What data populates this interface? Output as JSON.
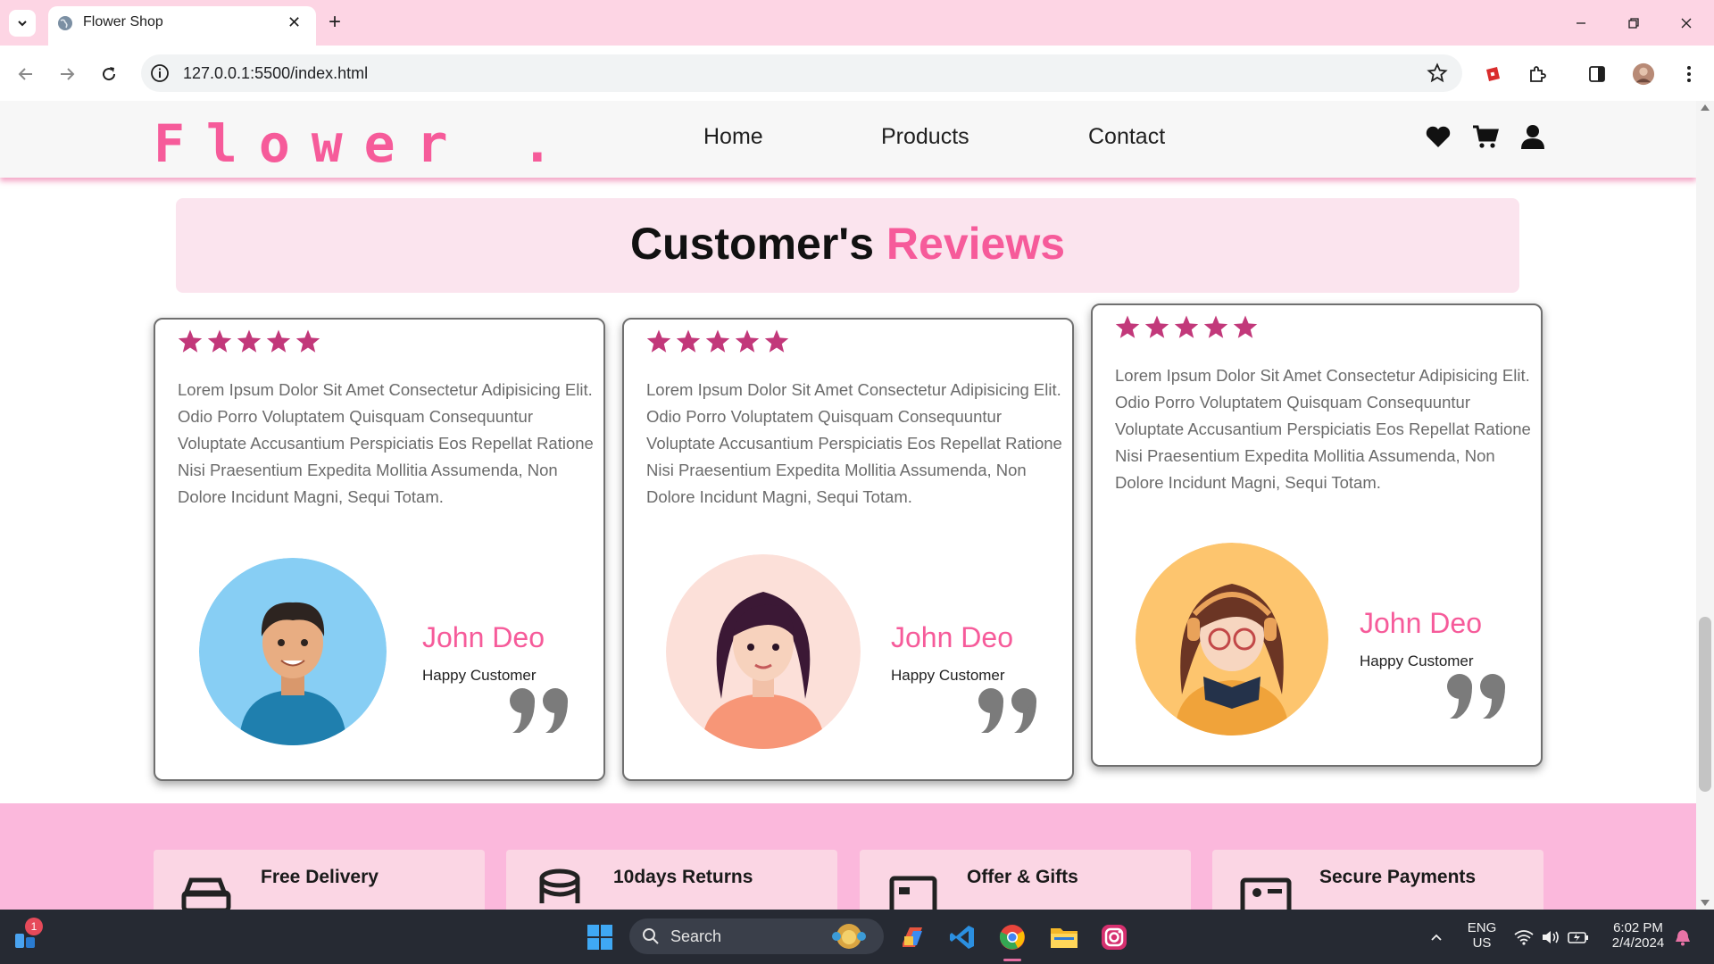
{
  "browser": {
    "tab_title": "Flower Shop",
    "url": "127.0.0.1:5500/index.html"
  },
  "site": {
    "logo": "Flower .",
    "nav": [
      "Home",
      "Products",
      "Contact"
    ]
  },
  "reviews": {
    "title_prefix": "Customer's",
    "title_accent": "Reviews",
    "items": [
      {
        "stars": 5,
        "text": "Lorem Ipsum Dolor Sit Amet Consectetur Adipisicing Elit. Odio Porro Voluptatem Quisquam Consequuntur Voluptate Accusantium Perspiciatis Eos Repellat Ratione Nisi Praesentium Expedita Mollitia Assumenda, Non Dolore Incidunt Magni, Sequi Totam.",
        "name": "John Deo",
        "role": "Happy Customer"
      },
      {
        "stars": 5,
        "text": "Lorem Ipsum Dolor Sit Amet Consectetur Adipisicing Elit. Odio Porro Voluptatem Quisquam Consequuntur Voluptate Accusantium Perspiciatis Eos Repellat Ratione Nisi Praesentium Expedita Mollitia Assumenda, Non Dolore Incidunt Magni, Sequi Totam.",
        "name": "John Deo",
        "role": "Happy Customer"
      },
      {
        "stars": 5,
        "text": "Lorem Ipsum Dolor Sit Amet Consectetur Adipisicing Elit. Odio Porro Voluptatem Quisquam Consequuntur Voluptate Accusantium Perspiciatis Eos Repellat Ratione Nisi Praesentium Expedita Mollitia Assumenda, Non Dolore Incidunt Magni, Sequi Totam.",
        "name": "John Deo",
        "role": "Happy Customer"
      }
    ]
  },
  "features": [
    "Free Delivery",
    "10days Returns",
    "Offer & Gifts",
    "Secure Payments"
  ],
  "taskbar": {
    "search_label": "Search",
    "notification_count": "1",
    "lang": "ENG",
    "region": "US",
    "time": "6:02 PM",
    "date": "2/4/2024"
  },
  "colors": {
    "accent": "#f65b9a",
    "star": "#c2387a",
    "tabbar": "#fdd5e4",
    "feature_band": "#fbb8dc"
  },
  "icons": {
    "header": [
      "heart-icon",
      "cart-icon",
      "user-icon"
    ],
    "features": [
      "truck-icon",
      "returns-icon",
      "gift-icon",
      "payment-icon"
    ]
  }
}
